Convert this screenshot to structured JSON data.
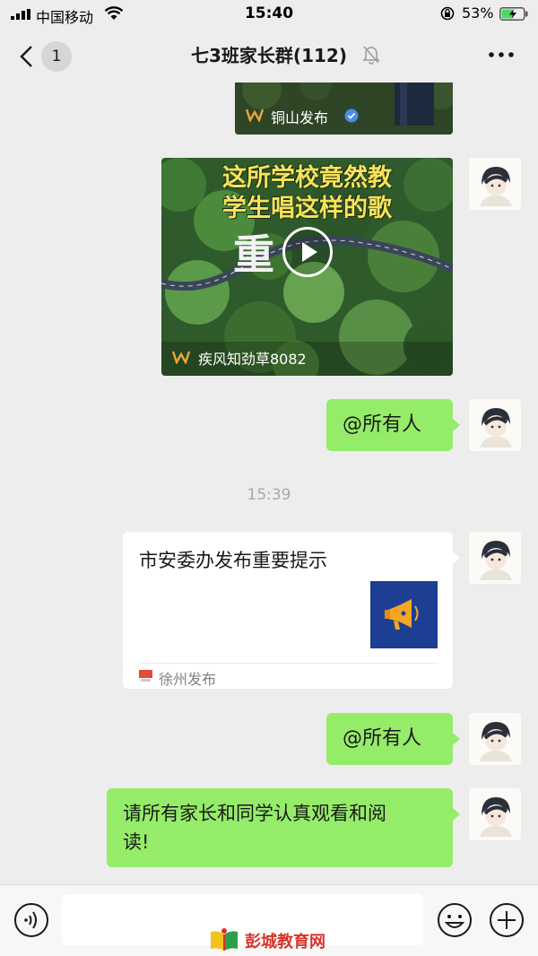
{
  "status_bar": {
    "carrier": "中国移动",
    "time": "15:40",
    "battery_percent": "53%",
    "battery_level": 0.53
  },
  "header": {
    "unread_count": "1",
    "title": "七3班家长群(112)"
  },
  "messages": {
    "partial_card": {
      "source": "铜山发布"
    },
    "video_card": {
      "caption_line1": "这所学校竟然教",
      "caption_line2": "学生唱这样的歌",
      "overlay_char": "重",
      "source": "疾风知劲草8082"
    },
    "mention1": {
      "text": "@所有人"
    },
    "timestamp": "15:39",
    "link_card": {
      "title": "市安委办发布重要提示",
      "source": "徐州发布"
    },
    "mention2": {
      "text": "@所有人"
    },
    "notice": {
      "line1": "请所有家长和同学认真观看和阅",
      "line2": "读!"
    }
  },
  "input_bar": {
    "value": ""
  },
  "watermark": {
    "text": "彭城教育网"
  },
  "colors": {
    "chat_bg": "#ededed",
    "bubble_green": "#95ec69",
    "timestamp_gray": "#a9a9a9",
    "battery_green": "#4cd964",
    "watermark_red": "#d8322a"
  },
  "icons": [
    "signal-icon",
    "wifi-icon",
    "rotation-lock-icon",
    "battery-icon",
    "back-chevron-icon",
    "mute-bell-icon",
    "more-dots-icon",
    "play-icon",
    "megaphone-icon",
    "voice-icon",
    "emoji-icon",
    "plus-icon"
  ]
}
